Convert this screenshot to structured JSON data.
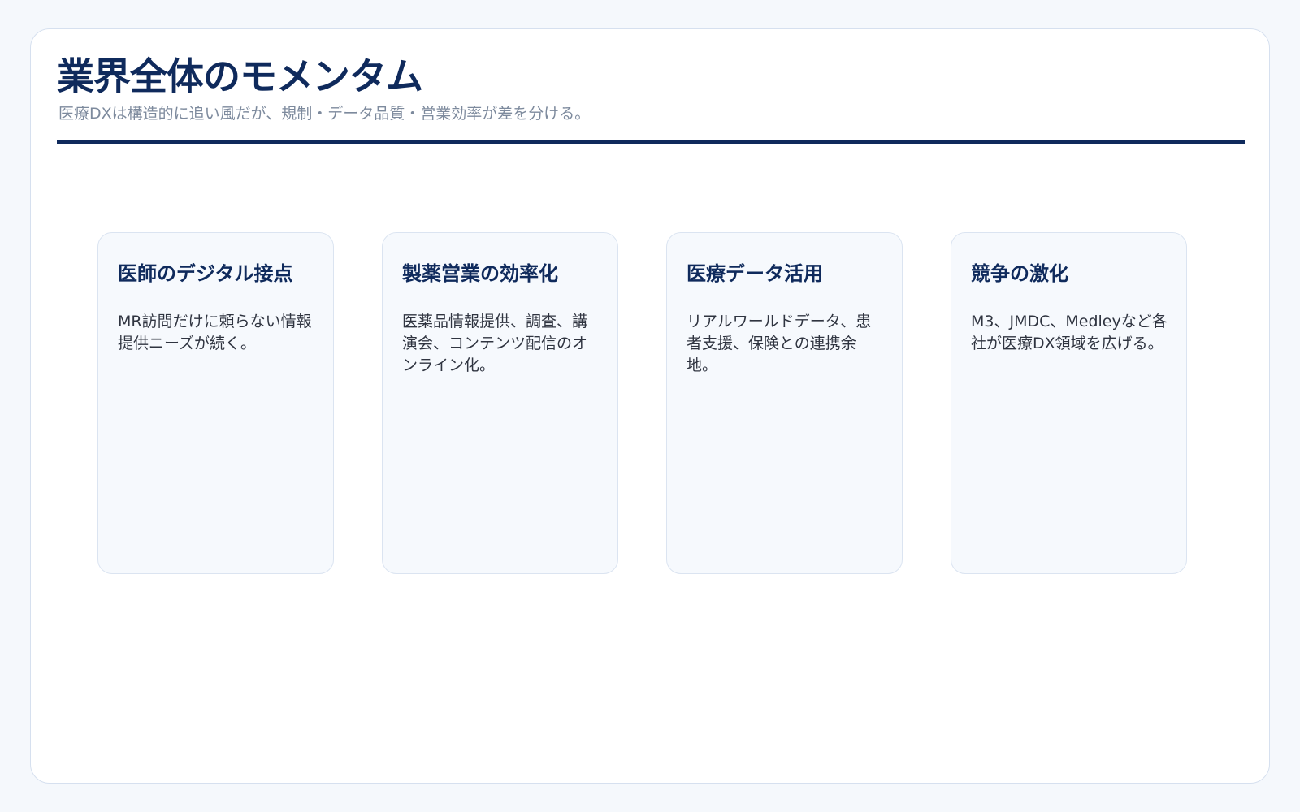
{
  "header": {
    "title": "業界全体のモメンタム",
    "subtitle": "医療DXは構造的に追い風だが、規制・データ品質・営業効率が差を分ける。"
  },
  "cards": [
    {
      "title": "医師のデジタル接点",
      "body": "MR訪問だけに頼らない情報提供ニーズが続く。"
    },
    {
      "title": "製薬営業の効率化",
      "body": "医薬品情報提供、調査、講演会、コンテンツ配信のオンライン化。"
    },
    {
      "title": "医療データ活用",
      "body": "リアルワールドデータ、患者支援、保険との連携余地。"
    },
    {
      "title": "競争の激化",
      "body": "M3、JMDC、Medleyなど各社が医療DX領域を広げる。"
    }
  ],
  "colors": {
    "accent": "#0f2a5c",
    "subtitle": "#7d8a9d",
    "card_background": "#f6f9fd",
    "page_background": "#f5f8fc"
  }
}
